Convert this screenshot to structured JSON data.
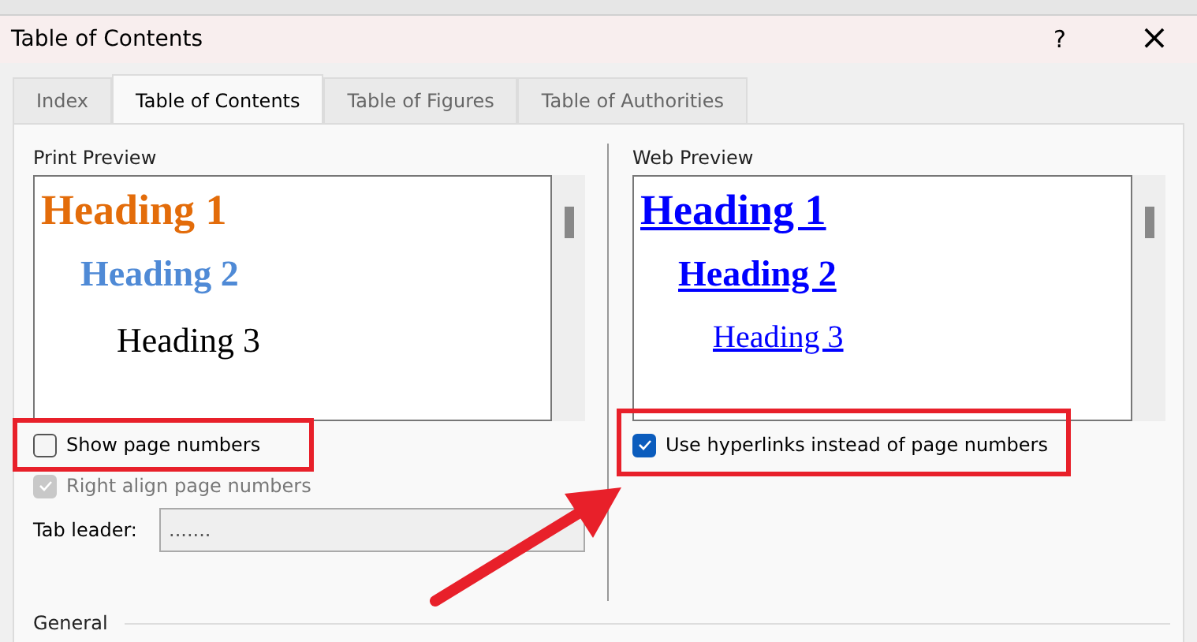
{
  "window": {
    "title": "Table of Contents",
    "help": "?",
    "close": "×"
  },
  "tabs": [
    {
      "label": "Index",
      "selected": false
    },
    {
      "label": "Table of Contents",
      "selected": true
    },
    {
      "label": "Table of Figures",
      "selected": false
    },
    {
      "label": "Table of Authorities",
      "selected": false
    }
  ],
  "print_preview": {
    "label": "Print Preview",
    "headings": [
      "Heading 1",
      "Heading 2",
      "Heading 3"
    ]
  },
  "web_preview": {
    "label": "Web Preview",
    "headings": [
      "Heading 1",
      "Heading 2",
      "Heading 3"
    ]
  },
  "left_options": [
    {
      "label": "Show page numbers",
      "checked": false,
      "disabled": false
    },
    {
      "label": "Right align page numbers",
      "checked": true,
      "disabled": true
    }
  ],
  "tab_leader": {
    "label": "Tab leader:",
    "value": ".......",
    "disabled": true
  },
  "right_options": [
    {
      "label": "Use hyperlinks instead of page numbers",
      "checked": true,
      "disabled": false
    }
  ],
  "general": {
    "label": "General"
  }
}
